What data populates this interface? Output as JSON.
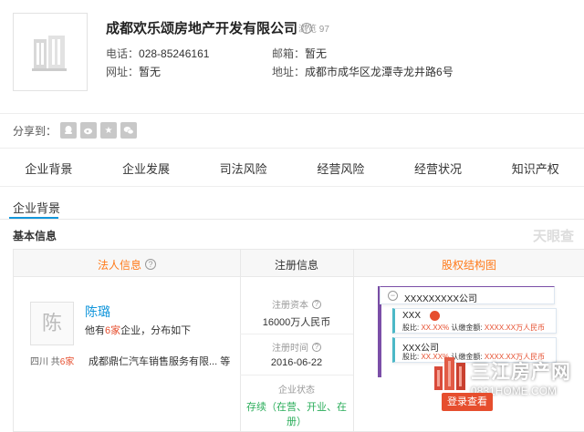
{
  "company": {
    "name": "成都欢乐颂房地产开发有限公司",
    "views": "浏览 97",
    "phone_label": "电话：",
    "phone": "028-85246161",
    "email_label": "邮箱：",
    "email": "暂无",
    "website_label": "网址：",
    "website": "暂无",
    "address_label": "地址：",
    "address": "成都市成华区龙潭寺龙井路6号"
  },
  "share": {
    "label": "分享到：",
    "buttons": [
      "qq-icon",
      "weibo-icon",
      "star-icon",
      "wechat-icon"
    ]
  },
  "tabs": [
    "企业背景",
    "企业发展",
    "司法风险",
    "经营风险",
    "经营状况",
    "知识产权"
  ],
  "subtab": "企业背景",
  "section_title": "基本信息",
  "watermark": "天眼查",
  "grid": {
    "legal_header": "法人信息",
    "reg_header": "注册信息",
    "equity_header": "股权结构图"
  },
  "legal": {
    "avatar_char": "陈",
    "name": "陈璐",
    "desc_prefix": "他有",
    "desc_count": "6家",
    "desc_suffix": "企业，分布如下",
    "region": "四川",
    "region_total_prefix": "共",
    "region_total": "6家",
    "companies": "成都鼎仁汽车销售服务有限...  等"
  },
  "registration": {
    "capital_label": "注册资本",
    "capital": "16000万人民币",
    "date_label": "注册时间",
    "date": "2016-06-22",
    "status_label": "企业状态",
    "status": "存续（在营、开业、在册）"
  },
  "equity": {
    "root": "XXXXXXXXX公司",
    "holders": [
      {
        "name": "XXX",
        "ratio_label": "股比:",
        "ratio": "XX.XX%",
        "amount_label": "认缴金额:",
        "amount": "XXXX.XX万人民币"
      },
      {
        "name": "XXX公司",
        "ratio_label": "股比:",
        "ratio": "XX.XX%",
        "amount_label": "认缴金额:",
        "amount": "XXXX.XX万人民币"
      }
    ]
  },
  "brand": {
    "name": "三江房产网",
    "url": "0831HOME.COM",
    "login": "登录查看"
  },
  "colors": {
    "accent_blue": "#1296db",
    "accent_orange": "#ff7a1a",
    "highlight_red": "#e64e2e",
    "status_green": "#2aad5a"
  }
}
